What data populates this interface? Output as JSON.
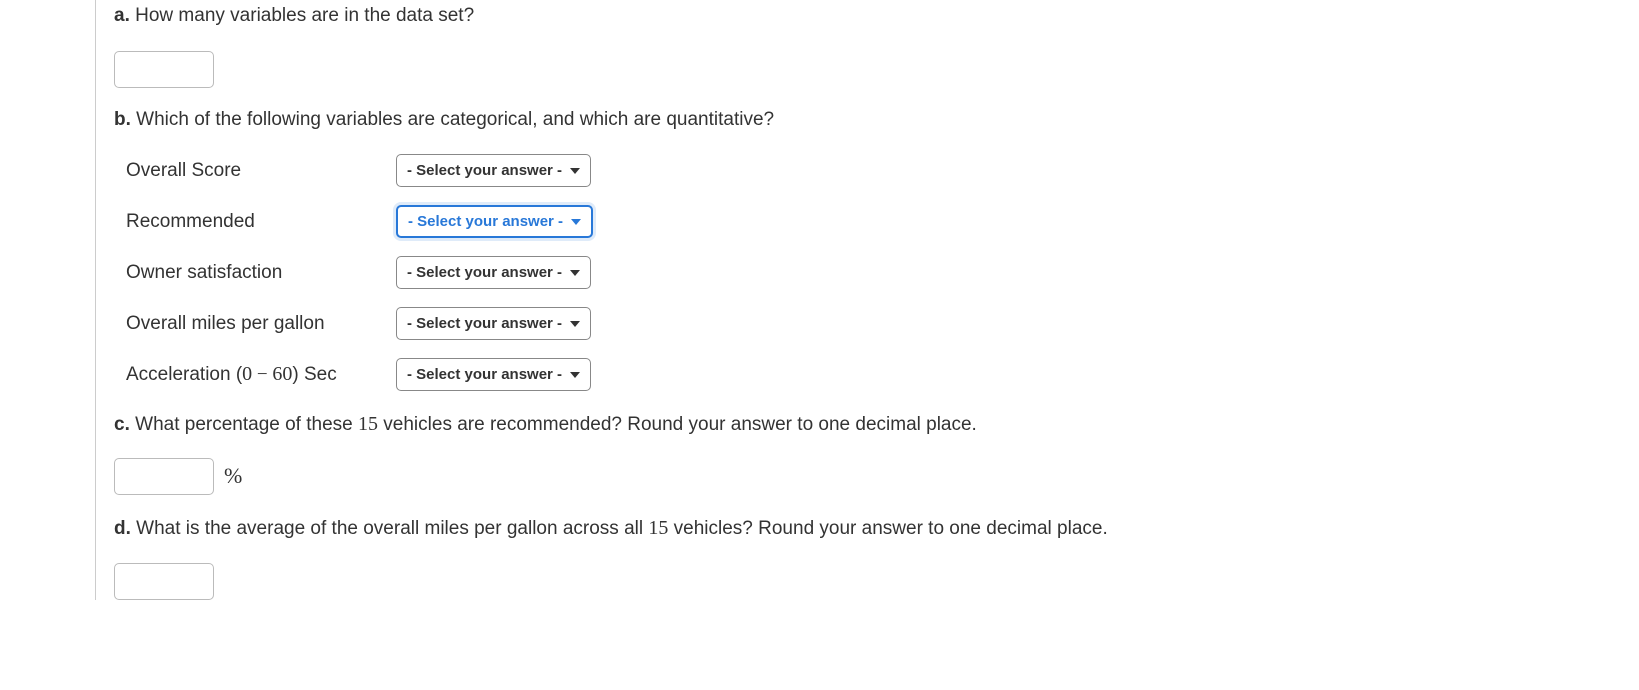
{
  "questions": {
    "a": {
      "label": "a.",
      "text": "How many variables are in the data set?"
    },
    "b": {
      "label": "b.",
      "text": "Which of the following variables are categorical, and which are quantitative?",
      "variables": [
        {
          "label": "Overall Score",
          "select": "- Select your answer -",
          "focused": false
        },
        {
          "label": "Recommended",
          "select": "- Select your answer -",
          "focused": true
        },
        {
          "label": "Owner satisfaction",
          "select": "- Select your answer -",
          "focused": false
        },
        {
          "label": "Overall miles per gallon",
          "select": "- Select your answer -",
          "focused": false
        },
        {
          "label_pre": "Acceleration (",
          "label_zero": "0",
          "label_minus": " − ",
          "label_sixty": "60",
          "label_post": ") Sec",
          "select": "- Select your answer -",
          "focused": false
        }
      ]
    },
    "c": {
      "label": "c.",
      "text_pre": "What percentage of these ",
      "count": "15",
      "text_post": " vehicles are recommended? Round your answer to one decimal place.",
      "unit": "%"
    },
    "d": {
      "label": "d.",
      "text_pre": "What is the average of the overall miles per gallon across all ",
      "count": "15",
      "text_post": " vehicles? Round your answer to one decimal place."
    }
  }
}
